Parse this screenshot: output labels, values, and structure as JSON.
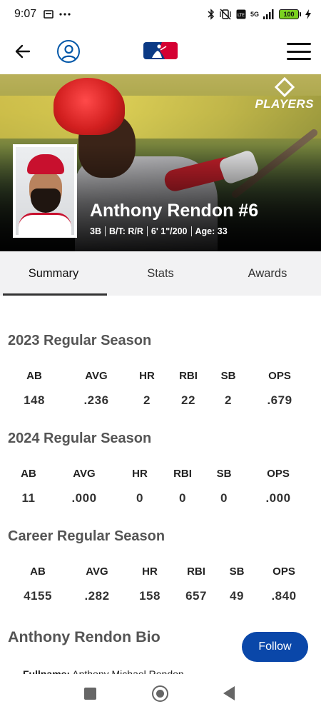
{
  "status_bar": {
    "time": "9:07",
    "network": "5G",
    "battery": "100",
    "icons": [
      "screen-icon",
      "more-dots-icon",
      "bluetooth-icon",
      "vibrate-off-icon",
      "volte-icon",
      "signal-icon",
      "battery-icon",
      "charging-icon"
    ]
  },
  "app_bar": {
    "icons": [
      "back-arrow-icon",
      "profile-icon",
      "mlb-logo",
      "hamburger-menu-icon"
    ]
  },
  "hero": {
    "badge_text": "PLAYERS",
    "player_name": "Anthony Rendon #6",
    "meta": [
      "3B",
      "B/T: R/R",
      "6' 1\"/200",
      "Age: 33"
    ]
  },
  "tabs": [
    {
      "label": "Summary",
      "active": true
    },
    {
      "label": "Stats",
      "active": false
    },
    {
      "label": "Awards",
      "active": false
    }
  ],
  "stat_columns": [
    "AB",
    "AVG",
    "HR",
    "RBI",
    "SB",
    "OPS"
  ],
  "seasons": [
    {
      "title": "2023 Regular Season",
      "values": [
        "148",
        ".236",
        "2",
        "22",
        "2",
        ".679"
      ]
    },
    {
      "title": "2024 Regular Season",
      "values": [
        "11",
        ".000",
        "0",
        "0",
        "0",
        ".000"
      ]
    },
    {
      "title": "Career Regular Season",
      "values": [
        "4155",
        ".282",
        "158",
        "657",
        "49",
        ".840"
      ]
    }
  ],
  "bio": {
    "title": "Anthony Rendon Bio",
    "follow_label": "Follow",
    "fullname_label": "Fullname:",
    "fullname_value": "Anthony Michael Rendon"
  },
  "colors": {
    "accent": "#0a47a9",
    "profile_ring": "#0057a8",
    "tabs_bg": "#f2f2f3"
  }
}
